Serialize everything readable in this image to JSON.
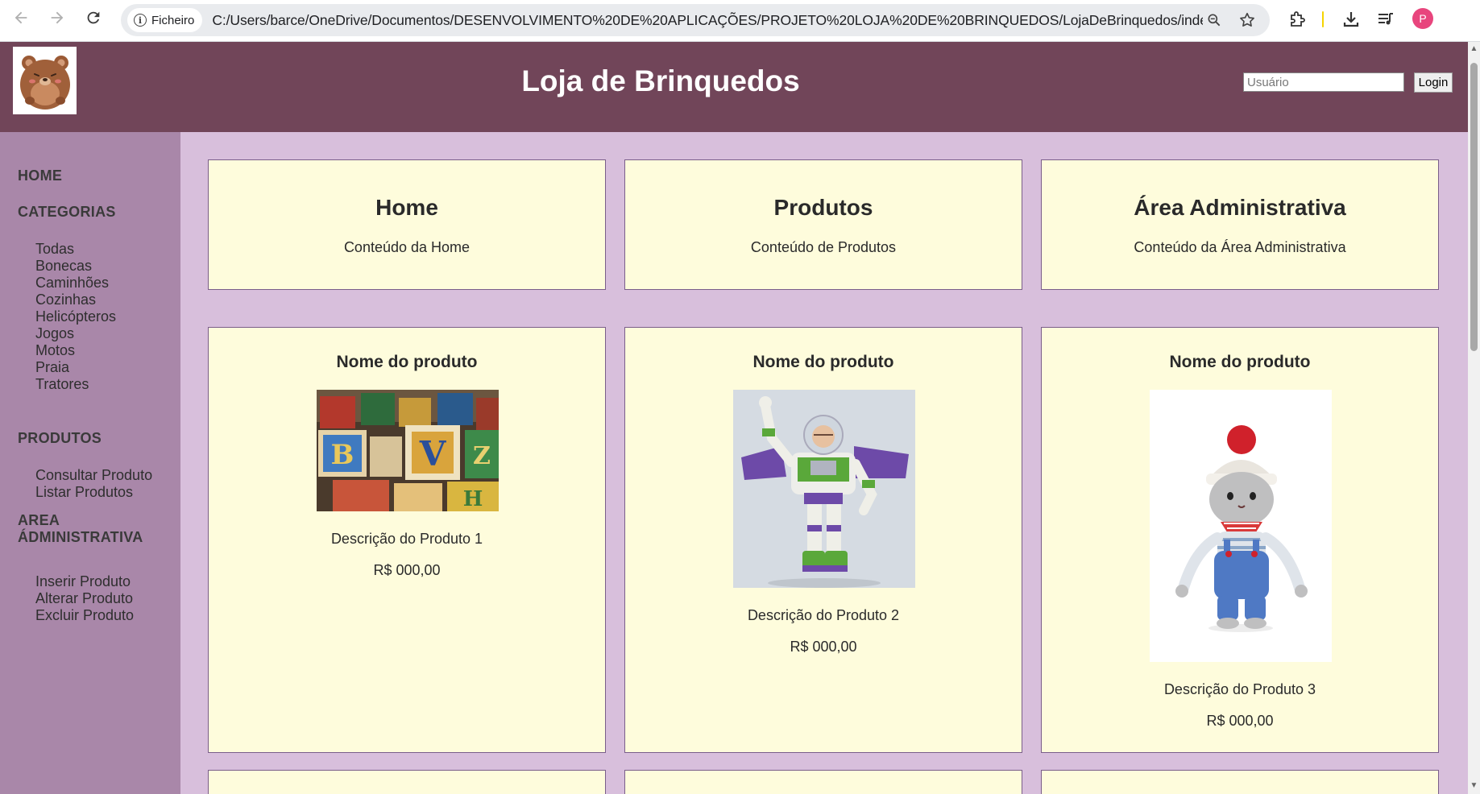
{
  "browser": {
    "site_info_label": "Ficheiro",
    "url": "C:/Users/barce/OneDrive/Documentos/DESENVOLVIMENTO%20DE%20APLICAÇÕES/PROJETO%20LOJA%20DE%20BRINQUEDOS/LojaDeBrinquedos/index.ht...",
    "avatar_letter": "P"
  },
  "header": {
    "title": "Loja de Brinquedos",
    "user_placeholder": "Usuário",
    "login_label": "Login"
  },
  "sidebar": {
    "home": "HOME",
    "categorias": "CATEGORIAS",
    "categories": [
      "Todas",
      "Bonecas",
      "Caminhões",
      "Cozinhas",
      "Helicópteros",
      "Jogos",
      "Motos",
      "Praia",
      "Tratores"
    ],
    "produtos": "PRODUTOS",
    "product_links": [
      "Consultar Produto",
      "Listar Produtos"
    ],
    "area_admin_line1": "AREA",
    "area_admin_line2": "ÁDMINISTRATIVA",
    "admin_links": [
      "Inserir Produto",
      "Alterar Produto",
      "Excluir Produto"
    ]
  },
  "sections": [
    {
      "title": "Home",
      "text": "Conteúdo da Home"
    },
    {
      "title": "Produtos",
      "text": "Conteúdo de Produtos"
    },
    {
      "title": "Área Administrativa",
      "text": "Conteúdo da Área Administrativa"
    }
  ],
  "products": [
    {
      "name": "Nome do produto",
      "description": "Descrição do Produto 1",
      "price": "R$ 000,00"
    },
    {
      "name": "Nome do produto",
      "description": "Descrição do Produto 2",
      "price": "R$ 000,00"
    },
    {
      "name": "Nome do produto",
      "description": "Descrição do Produto 3",
      "price": "R$ 000,00"
    }
  ],
  "colors": {
    "header_bg": "#714559",
    "sidebar_bg": "#a987a9",
    "main_bg": "#d8bfdc",
    "card_bg": "#fefcdc"
  }
}
